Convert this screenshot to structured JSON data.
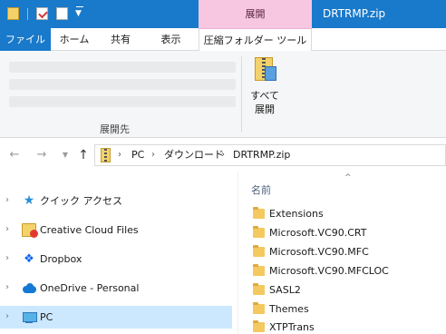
{
  "window": {
    "title": "DRTRMP.zip",
    "context_tab": "展開"
  },
  "ribbon_tabs": {
    "file": "ファイル",
    "home": "ホーム",
    "share": "共有",
    "view": "表示",
    "tools": "圧縮フォルダー ツール"
  },
  "ribbon": {
    "extract_to_group": "展開先",
    "extract_all_line1": "すべて",
    "extract_all_line2": "展開"
  },
  "address": {
    "crumbs": [
      "PC",
      "ダウンロード",
      "DRTRMP.zip"
    ],
    "separator": "›"
  },
  "nav_pane": {
    "items": [
      {
        "label": "クイック アクセス",
        "icon": "star-icon"
      },
      {
        "label": "Creative Cloud Files",
        "icon": "creative-cloud-folder-icon"
      },
      {
        "label": "Dropbox",
        "icon": "dropbox-icon"
      },
      {
        "label": "OneDrive - Personal",
        "icon": "onedrive-cloud-icon"
      },
      {
        "label": "PC",
        "icon": "pc-icon"
      }
    ],
    "selected": "PC"
  },
  "file_list": {
    "column_name": "名前",
    "files": [
      "Extensions",
      "Microsoft.VC90.CRT",
      "Microsoft.VC90.MFC",
      "Microsoft.VC90.MFCLOC",
      "SASL2",
      "Themes",
      "XTPTrans"
    ]
  },
  "colors": {
    "titlebar": "#1979ca",
    "context_tab": "#f7c7e2",
    "selection": "#cce8ff",
    "folder": "#f3c960"
  }
}
